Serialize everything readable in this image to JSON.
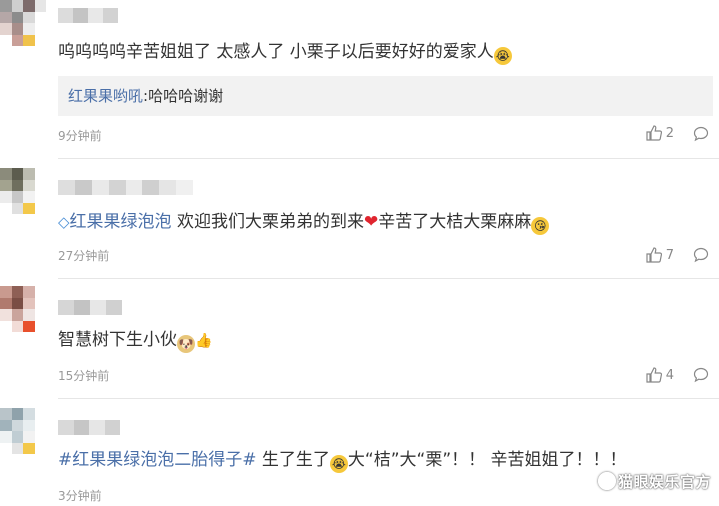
{
  "comments": [
    {
      "text": "呜呜呜呜辛苦姐姐了 太感人了 小栗子以后要好好的爱家人",
      "emoji": "crying-emoji",
      "reply": {
        "author": "红果果哟吼",
        "sep": ":",
        "text": "哈哈哈谢谢"
      },
      "time": "9分钟前",
      "likes": "2"
    },
    {
      "mention": "红果果绿泡泡",
      "text1": " 欢迎我们大栗弟弟的到来",
      "text2": "辛苦了大桔大栗麻麻",
      "time": "27分钟前",
      "likes": "7"
    },
    {
      "text": "智慧树下生小伙",
      "time": "15分钟前",
      "likes": "4"
    },
    {
      "hashtag": "#红果果绿泡泡二胎得子#",
      "text1": " 生了生了",
      "text2": "大“桔”大“栗”！！ 辛苦姐姐了！！！",
      "time": "3分钟前"
    }
  ],
  "watermark": "猫眼娱乐官方",
  "colors": {
    "link": "#4a6fa8",
    "time": "#999999",
    "reply_bg": "#f2f2f2"
  }
}
